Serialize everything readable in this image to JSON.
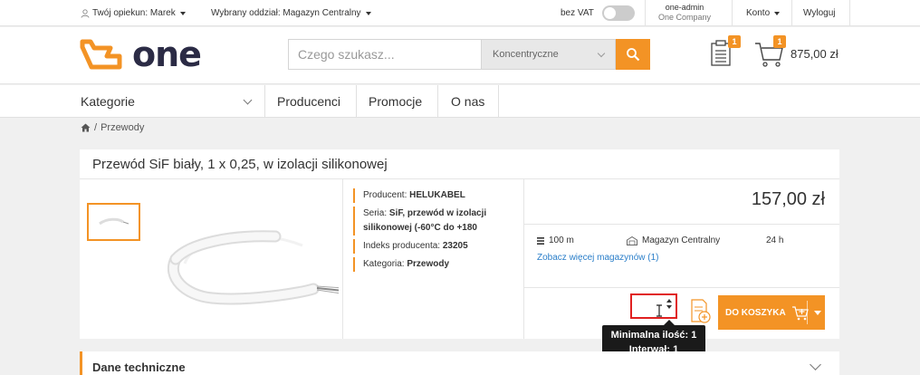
{
  "topbar": {
    "guardian_label": "Twój opiekun: Marek",
    "branch_label": "Wybrany oddział: Magazyn Centralny",
    "vat_label": "bez VAT",
    "account_user": "one-admin",
    "account_company": "One Company",
    "account_menu": "Konto",
    "logout": "Wyloguj"
  },
  "header": {
    "logo_text": "one",
    "search_placeholder": "Czego szukasz...",
    "search_category": "Koncentryczne",
    "list_badge": "1",
    "cart_badge": "1",
    "cart_total": "875,00 zł"
  },
  "nav": {
    "items": [
      "Kategorie",
      "Producenci",
      "Promocje",
      "O nas"
    ]
  },
  "breadcrumb": {
    "current": "Przewody"
  },
  "product": {
    "title": "Przewód SiF biały, 1 x 0,25, w izolacji silikonowej",
    "info": [
      {
        "label": "Producent:",
        "value": "HELUKABEL"
      },
      {
        "label": "Seria:",
        "value": "SiF, przewód w izolacji silikonowej (-60°C do +180"
      },
      {
        "label": "Indeks producenta:",
        "value": "23205"
      },
      {
        "label": "Kategoria:",
        "value": "Przewody"
      }
    ],
    "price": "157,00 zł",
    "stock_qty": "100 m",
    "stock_warehouse": "Magazyn Centralny",
    "stock_time": "24 h",
    "more_warehouses": "Zobacz więcej magazynów (1)",
    "add_to_cart": "DO KOSZYKA"
  },
  "tooltip": {
    "min_qty": "Minimalna ilość: 1",
    "interval": "Interwał: 1"
  },
  "section": {
    "tech_data": "Dane techniczne"
  },
  "colors": {
    "accent": "#f39325",
    "link": "#2a7ec9",
    "error": "#e02020"
  }
}
